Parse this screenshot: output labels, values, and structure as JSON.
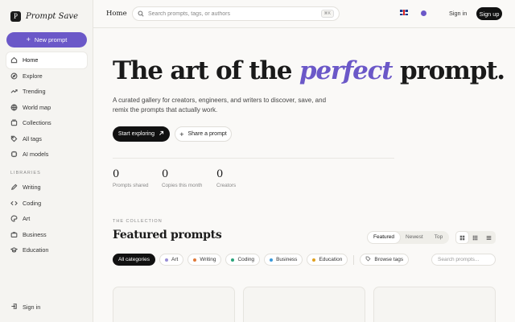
{
  "brand": {
    "logo_letter": "P",
    "name": "Prompt Save"
  },
  "sidebar": {
    "new_prompt_label": "New prompt",
    "items": [
      {
        "label": "Home",
        "icon": "home-icon",
        "active": true
      },
      {
        "label": "Explore",
        "icon": "compass-icon"
      },
      {
        "label": "Trending",
        "icon": "trending-icon"
      },
      {
        "label": "World map",
        "icon": "globe-icon"
      },
      {
        "label": "Collections",
        "icon": "collections-icon"
      },
      {
        "label": "All tags",
        "icon": "tag-icon"
      },
      {
        "label": "AI models",
        "icon": "sparkle-icon"
      }
    ],
    "libraries_label": "LIBRARIES",
    "libraries": [
      {
        "label": "Writing",
        "icon": "pen-icon"
      },
      {
        "label": "Coding",
        "icon": "code-icon"
      },
      {
        "label": "Art",
        "icon": "palette-icon"
      },
      {
        "label": "Business",
        "icon": "briefcase-icon"
      },
      {
        "label": "Education",
        "icon": "graduation-cap-icon"
      }
    ],
    "sign_in_label": "Sign in"
  },
  "topbar": {
    "breadcrumb": "Home",
    "search_placeholder": "Search prompts, tags, or authors",
    "shortcut": "⌘K",
    "sign_in": "Sign in",
    "sign_up": "Sign up"
  },
  "hero": {
    "title_before": "The art of the ",
    "title_emphasis": "perfect",
    "title_after": " prompt.",
    "subtitle": "A curated gallery for creators, engineers, and writers to discover, save, and remix the prompts that actually work.",
    "primary_cta": "Start exploring",
    "secondary_cta": "Share a prompt"
  },
  "stats": [
    {
      "value": "0",
      "label": "Prompts shared"
    },
    {
      "value": "0",
      "label": "Copies this month"
    },
    {
      "value": "0",
      "label": "Creators"
    }
  ],
  "collection": {
    "eyebrow": "THE COLLECTION",
    "title": "Featured prompts",
    "sort_tabs": [
      "Featured",
      "Newest",
      "Top"
    ],
    "active_sort": "Featured",
    "categories": [
      {
        "label": "All categories",
        "active": true
      },
      {
        "label": "Art",
        "color": "#9a8fd6"
      },
      {
        "label": "Writing",
        "color": "#e07a3a"
      },
      {
        "label": "Coding",
        "color": "#2aa37a"
      },
      {
        "label": "Business",
        "color": "#3a9ad9"
      },
      {
        "label": "Education",
        "color": "#e0a020"
      }
    ],
    "browse_tags": "Browse tags",
    "search_placeholder": "Search prompts..."
  },
  "colors": {
    "accent": "#6b58c8",
    "dark": "#111111"
  }
}
